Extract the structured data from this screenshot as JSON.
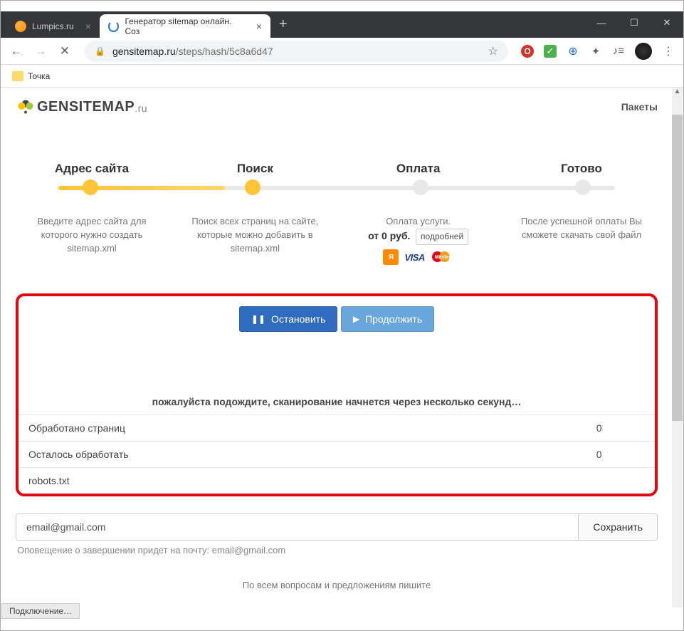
{
  "window": {
    "tab1_title": "Lumpics.ru",
    "tab2_title": "Генератор sitemap онлайн. Соз",
    "min": "—",
    "max": "☐",
    "close": "✕",
    "newtab": "+"
  },
  "address": {
    "url_domain": "gensitemap.ru",
    "url_path": "/steps/hash/5c8a6d47",
    "star": "☆"
  },
  "bookmarks": {
    "item1": "Точка"
  },
  "header": {
    "logo_text": "GENSITEMAP",
    "logo_suffix": ".ru",
    "packages": "Пакеты"
  },
  "steps": {
    "s1_title": "Адрес сайта",
    "s1_desc": "Введите адрес сайта для которого нужно создать sitemap.xml",
    "s2_title": "Поиск",
    "s2_desc": "Поиск всех страниц на сайте, которые можно добавить в sitemap.xml",
    "s3_title": "Оплата",
    "s3_desc": "Оплата услуги.",
    "s3_price": "от 0 руб.",
    "s3_details": "подробней",
    "s4_title": "Готово",
    "s4_desc": "После успешной оплаты Вы сможете скачать свой файл"
  },
  "panel": {
    "stop_label": "Остановить",
    "cont_label": "Продолжить",
    "wait_msg": "пожалуйста подождите, сканирование начнется через несколько секунд…",
    "row1_label": "Обработано страниц",
    "row1_val": "0",
    "row2_label": "Осталось обработать",
    "row2_val": "0",
    "row3_label": "robots.txt",
    "row3_val": ""
  },
  "email": {
    "value": "email@gmail.com",
    "save": "Сохранить",
    "note": "Оповещение о завершении придет на почту: email@gmail.com"
  },
  "footer": {
    "text": "По всем вопросам и предложениям пишите"
  },
  "statusbar": {
    "text": "Подключение…"
  }
}
